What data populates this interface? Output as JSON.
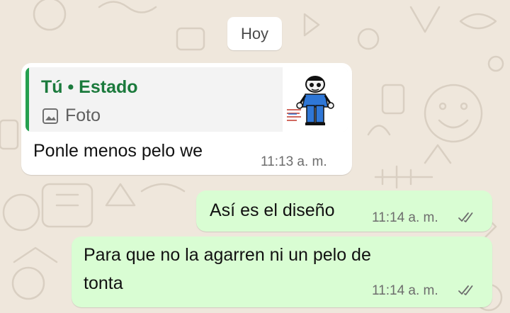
{
  "date_label": "Hoy",
  "incoming": {
    "quote": {
      "title": "Tú • Estado",
      "media_label": "Foto",
      "media_icon": "photo-icon",
      "accent_color": "#25a04f"
    },
    "text": "Ponle menos pelo we",
    "time": "11:13 a. m."
  },
  "outgoing": [
    {
      "lines": [
        "Así es el diseño"
      ],
      "time": "11:14 a. m.",
      "status": "read"
    },
    {
      "lines": [
        "Para que no la agarren ni un pelo de",
        "tonta"
      ],
      "time": "11:14 a. m.",
      "status": "read"
    }
  ],
  "colors": {
    "wallpaper": "#efe7dc",
    "outgoing_bubble": "#d9fdd3",
    "incoming_bubble": "#ffffff",
    "ticks": "#6d6d6d"
  }
}
